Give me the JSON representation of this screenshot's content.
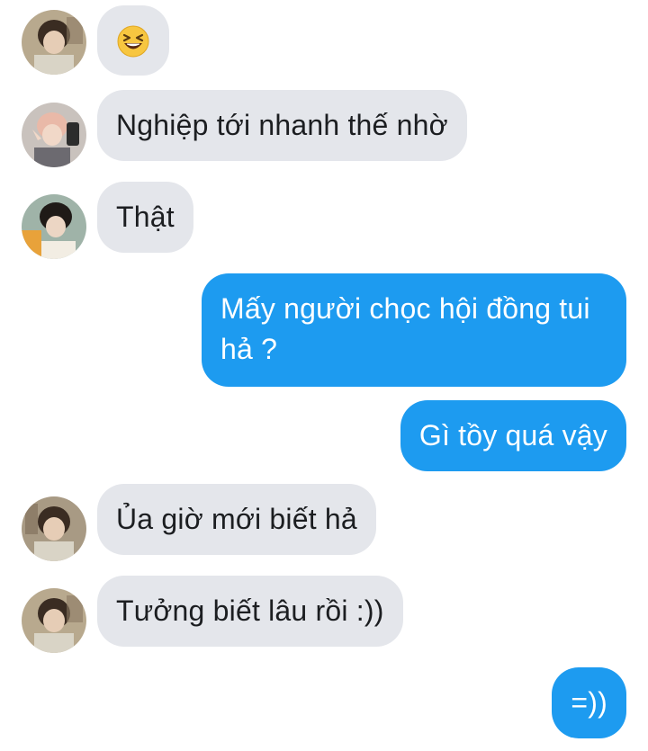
{
  "messages": [
    {
      "type": "incoming",
      "kind": "emoji",
      "emoji": "laughing-squint-face"
    },
    {
      "type": "incoming",
      "text": "Nghiệp tới nhanh thế nhờ"
    },
    {
      "type": "incoming",
      "text": "Thật"
    },
    {
      "type": "outgoing",
      "text": "Mấy người chọc hội đồng tui hả ?"
    },
    {
      "type": "outgoing",
      "text": "Gì tồy quá vậy"
    },
    {
      "type": "incoming",
      "text": "Ủa giờ mới biết hả"
    },
    {
      "type": "incoming",
      "text": "Tưởng biết lâu rồi :))"
    },
    {
      "type": "outgoing",
      "text": "=))"
    }
  ],
  "colors": {
    "incoming_bubble": "#e4e6eb",
    "outgoing_bubble": "#1d9bf0",
    "incoming_text": "#1c1e21",
    "outgoing_text": "#ffffff"
  }
}
